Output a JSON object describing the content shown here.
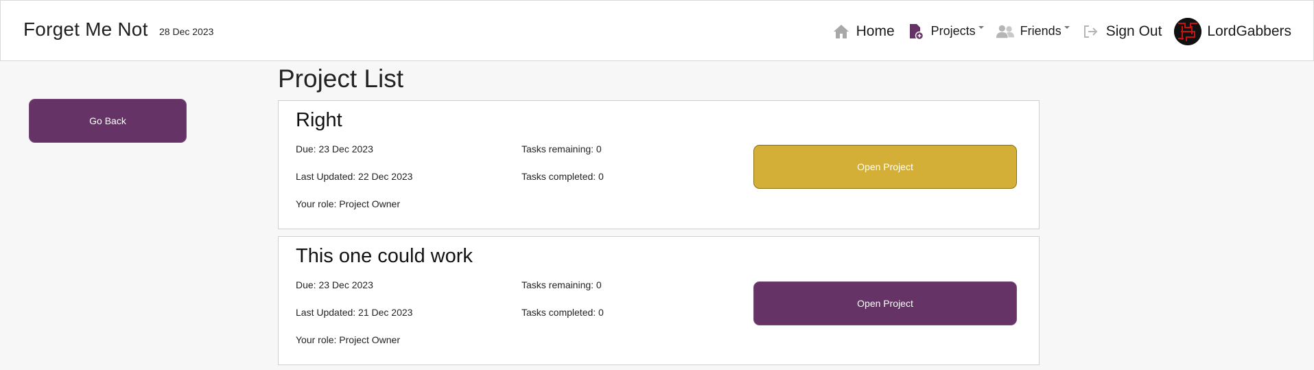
{
  "app": {
    "title": "Forget Me Not",
    "date": "28 Dec 2023"
  },
  "nav": {
    "home": {
      "label": "Home",
      "icon": "home-icon"
    },
    "projects": {
      "label": "Projects",
      "icon": "project-file-icon"
    },
    "friends": {
      "label": "Friends",
      "icon": "friends-icon"
    },
    "sign_out": {
      "label": "Sign Out",
      "icon": "sign-out-icon"
    },
    "user": {
      "name": "LordGabbers",
      "icon": "avatar"
    }
  },
  "sidebar": {
    "go_back_label": "Go Back"
  },
  "main": {
    "title": "Project List",
    "projects": [
      {
        "name": "Right",
        "due": "Due: 23 Dec 2023",
        "last_updated": "Last Updated: 22 Dec 2023",
        "role": "Your role: Project Owner",
        "tasks_remaining": "Tasks remaining: 0",
        "tasks_completed": "Tasks completed: 0",
        "button_label": "Open Project",
        "button_color": "#d4af37"
      },
      {
        "name": "This one could work",
        "due": "Due: 23 Dec 2023",
        "last_updated": "Last Updated: 21 Dec 2023",
        "role": "Your role: Project Owner",
        "tasks_remaining": "Tasks remaining: 0",
        "tasks_completed": "Tasks completed: 0",
        "button_label": "Open Project",
        "button_color": "#663366"
      }
    ]
  },
  "colors": {
    "primary": "#663366",
    "highlight": "#d4af37",
    "background": "#f7f7f7"
  }
}
